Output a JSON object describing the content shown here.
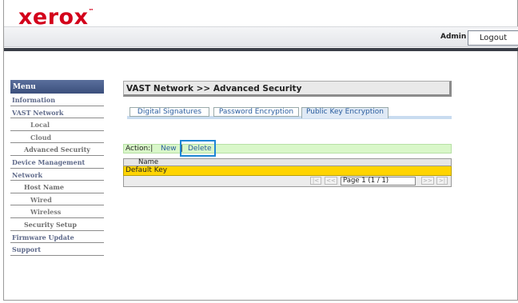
{
  "header": {
    "logo_text": "xerox",
    "trademark": "™",
    "user_label": "Admin",
    "logout_label": "Logout"
  },
  "menu": {
    "title": "Menu",
    "items": [
      {
        "label": "Information",
        "level": "top"
      },
      {
        "label": "VAST Network",
        "level": "top"
      },
      {
        "label": "Local",
        "level": "sub"
      },
      {
        "label": "Cloud",
        "level": "sub"
      },
      {
        "label": "Advanced Security",
        "level": "sub"
      },
      {
        "label": "Device Management",
        "level": "top"
      },
      {
        "label": "Network",
        "level": "top"
      },
      {
        "label": "Host Name",
        "level": "sub"
      },
      {
        "label": "Wired",
        "level": "sub"
      },
      {
        "label": "Wireless",
        "level": "sub"
      },
      {
        "label": "Security Setup",
        "level": "sub"
      },
      {
        "label": "Firmware Update",
        "level": "top"
      },
      {
        "label": "Support",
        "level": "top"
      }
    ]
  },
  "content": {
    "breadcrumb": "VAST Network >> Advanced Security",
    "tabs": [
      "Digital Signatures",
      "Password Encryption",
      "Public Key Encryption"
    ],
    "active_tab": "Public Key Encryption",
    "action_label": "Action:|",
    "action_new": "New",
    "action_delete": "Delete",
    "table": {
      "header_name": "Name",
      "rows": [
        "Default Key"
      ],
      "page_text": "Page 1 (1 / 1)",
      "first": "|<",
      "prev": "<<",
      "next": ">>",
      "last": ">|"
    }
  },
  "colors": {
    "logo": "#d3001b",
    "menu_header": "#3b4f7c",
    "action_bar": "#d9f7c9",
    "selected_row": "#ffd400",
    "highlight_box": "#1f87d6"
  }
}
